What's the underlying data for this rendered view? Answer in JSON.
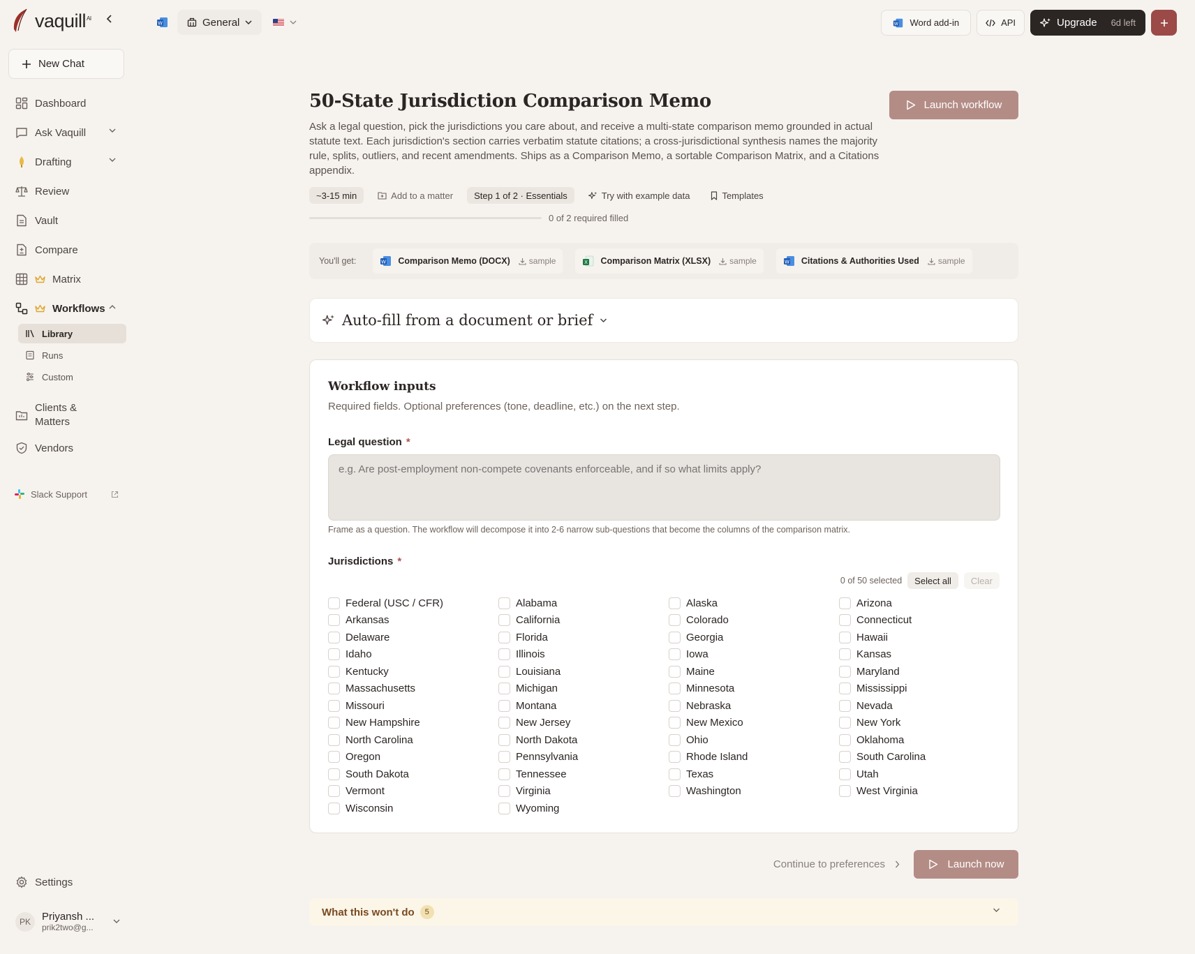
{
  "brand": {
    "name": "vaquill",
    "suffix": "AI"
  },
  "sidebar": {
    "new_chat": "New Chat",
    "items": [
      {
        "label": "Dashboard",
        "icon": "dashboard-icon"
      },
      {
        "label": "Ask Vaquill",
        "icon": "chat-bubble-icon"
      },
      {
        "label": "Drafting",
        "icon": "pen-nib-icon"
      },
      {
        "label": "Review",
        "icon": "scales-icon"
      },
      {
        "label": "Vault",
        "icon": "document-icon"
      },
      {
        "label": "Compare",
        "icon": "compare-icon"
      },
      {
        "label": "Matrix",
        "icon": "table-grid-icon"
      },
      {
        "label": "Workflows",
        "icon": "workflow-icon"
      },
      {
        "label": "Clients & Matters",
        "icon": "folder-icon"
      },
      {
        "label": "Vendors",
        "icon": "shield-icon"
      }
    ],
    "workflow_sub": [
      {
        "label": "Library",
        "icon": "library-icon"
      },
      {
        "label": "Runs",
        "icon": "runs-icon"
      },
      {
        "label": "Custom",
        "icon": "sliders-icon"
      }
    ],
    "slack": "Slack Support",
    "settings": "Settings",
    "user": {
      "initials": "PK",
      "name": "Priyansh ...",
      "email": "prik2two@g..."
    }
  },
  "topbar": {
    "workspace": "General",
    "word_addin": "Word add-in",
    "api": "API",
    "upgrade": "Upgrade",
    "trial_left": "6d left"
  },
  "workflow": {
    "title": "50-State Jurisdiction Comparison Memo",
    "launch": "Launch workflow",
    "description": "Ask a legal question, pick the jurisdictions you care about, and receive a multi-state comparison memo grounded in actual statute text. Each jurisdiction's section carries verbatim statute citations; a cross-jurisdictional synthesis names the majority rule, splits, outliers, and recent amendments. Ships as a Comparison Memo, a sortable Comparison Matrix, and a Citations appendix.",
    "duration": "~3-15 min",
    "add_matter": "Add to a matter",
    "step": "Step 1 of 2 · Essentials",
    "try_example": "Try with example data",
    "templates": "Templates",
    "progress_text": "0 of 2 required filled",
    "progress_fraction": 0,
    "youget_label": "You'll get:",
    "deliverables": [
      {
        "name": "Comparison Memo (DOCX)",
        "sample": "sample",
        "icon": "word-icon"
      },
      {
        "name": "Comparison Matrix (XLSX)",
        "sample": "sample",
        "icon": "excel-icon"
      },
      {
        "name": "Citations & Authorities Used",
        "sample": "sample",
        "icon": "word-icon"
      }
    ],
    "autofill": "Auto-fill from a document or brief",
    "inputs_title": "Workflow inputs",
    "inputs_sub": "Required fields. Optional preferences (tone, deadline, etc.) on the next step.",
    "legal_question_label": "Legal question",
    "legal_question_placeholder": "e.g. Are post-employment non-compete covenants enforceable, and if so what limits apply?",
    "legal_question_hint": "Frame as a question. The workflow will decompose it into 2-6 narrow sub-questions that become the columns of the comparison matrix.",
    "jurisdictions_label": "Jurisdictions",
    "selected_count": "0 of 50 selected",
    "select_all": "Select all",
    "clear": "Clear",
    "jurisdictions": [
      "Federal (USC / CFR)",
      "Alabama",
      "Alaska",
      "Arizona",
      "Arkansas",
      "California",
      "Colorado",
      "Connecticut",
      "Delaware",
      "Florida",
      "Georgia",
      "Hawaii",
      "Idaho",
      "Illinois",
      "Iowa",
      "Kansas",
      "Kentucky",
      "Louisiana",
      "Maine",
      "Maryland",
      "Massachusetts",
      "Michigan",
      "Minnesota",
      "Mississippi",
      "Missouri",
      "Montana",
      "Nebraska",
      "Nevada",
      "New Hampshire",
      "New Jersey",
      "New Mexico",
      "New York",
      "North Carolina",
      "North Dakota",
      "Ohio",
      "Oklahoma",
      "Oregon",
      "Pennsylvania",
      "Rhode Island",
      "South Carolina",
      "South Dakota",
      "Tennessee",
      "Texas",
      "Utah",
      "Vermont",
      "Virginia",
      "Washington",
      "West Virginia",
      "Wisconsin",
      "Wyoming"
    ],
    "continue": "Continue to preferences",
    "launch_now": "Launch now",
    "wont_do": "What this won't do",
    "wont_count": "5"
  },
  "colors": {
    "accent": "#9b4a47",
    "accent_muted": "#b48c86",
    "background": "#f6f3ef"
  }
}
